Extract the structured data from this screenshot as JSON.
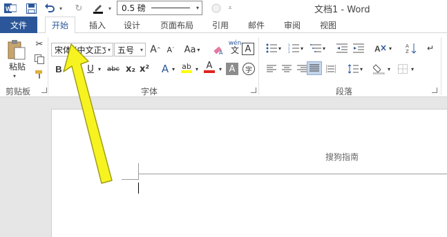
{
  "window": {
    "title": "文档1 - Word"
  },
  "quick_access": {
    "pen_weight": "0.5 磅"
  },
  "tabs": {
    "file": "文件",
    "home": "开始",
    "insert": "插入",
    "design": "设计",
    "layout": "页面布局",
    "references": "引用",
    "mailings": "邮件",
    "review": "审阅",
    "view": "视图"
  },
  "clipboard": {
    "paste_label": "粘贴",
    "group_label": "剪贴板"
  },
  "font": {
    "family": "宋体 (中文正文)",
    "size": "五号",
    "group_label": "字体",
    "bold": "B",
    "italic": "I",
    "underline": "U",
    "strike": "abc",
    "subscript": "x₂",
    "superscript": "x²",
    "grow": "A",
    "shrink": "A",
    "case": "Aa",
    "phonetic": "wén",
    "phonetic_char": "文",
    "border_char": "A",
    "highlight": "ab",
    "color": "A",
    "shading": "A",
    "enclose": "字"
  },
  "paragraph": {
    "group_label": "段落"
  },
  "document": {
    "header_text": "搜狗指南"
  },
  "colors": {
    "accent": "#2b579a",
    "arrow": "#f7f320",
    "highlight": "#ffff00",
    "font_red": "#e0231d"
  }
}
